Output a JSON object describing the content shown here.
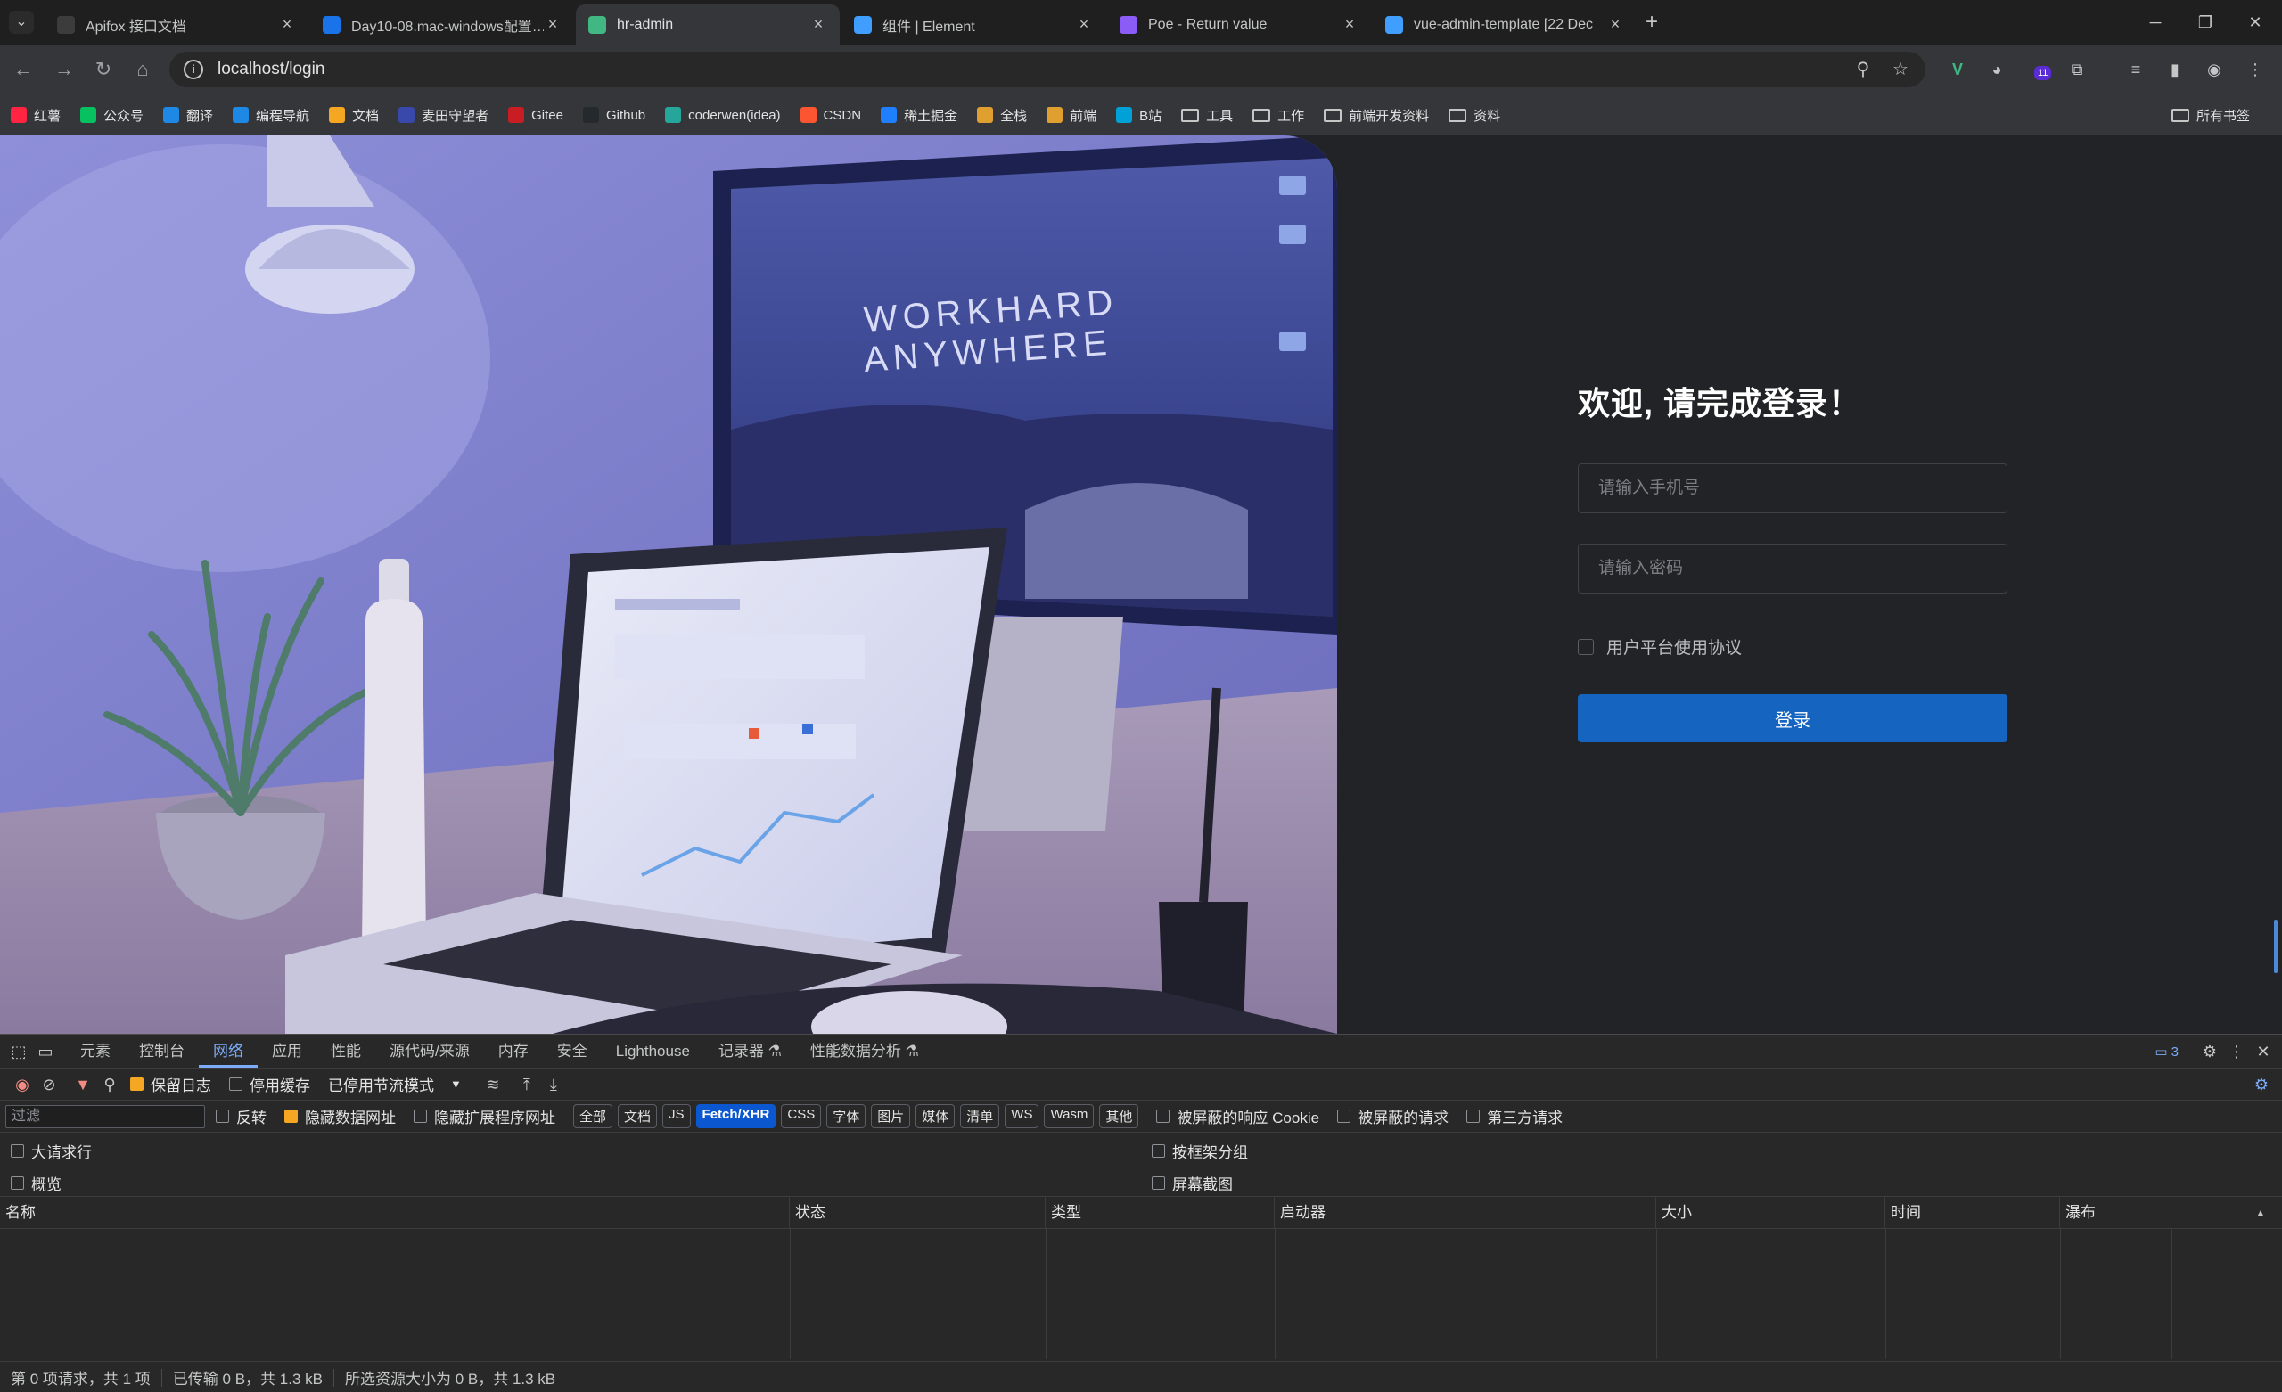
{
  "tabs": [
    {
      "title": "Apifox 接口文档",
      "icon": "apifox-icon",
      "color": "#3c3c3c"
    },
    {
      "title": "Day10-08.mac-windows配置…",
      "icon": "doc-icon",
      "color": "#1a73e8"
    },
    {
      "title": "hr-admin",
      "icon": "vue-icon",
      "color": "#41b883",
      "active": true
    },
    {
      "title": "组件 | Element",
      "icon": "element-icon",
      "color": "#409eff"
    },
    {
      "title": "Poe - Return value",
      "icon": "poe-icon",
      "color": "#8b5cf6"
    },
    {
      "title": "vue-admin-template [22 Dec",
      "icon": "vue-icon",
      "color": "#409eff"
    }
  ],
  "address": {
    "url": "localhost/login"
  },
  "extensions": {
    "badge": "11"
  },
  "bookmarks": [
    {
      "label": "红薯",
      "color": "#ff2442"
    },
    {
      "label": "公众号",
      "color": "#07c160"
    },
    {
      "label": "翻译",
      "color": "#1e88e5"
    },
    {
      "label": "编程导航",
      "color": "#1e88e5"
    },
    {
      "label": "文档",
      "color": "#f5a623"
    },
    {
      "label": "麦田守望者",
      "color": "#3949ab"
    },
    {
      "label": "Gitee",
      "color": "#c71d23"
    },
    {
      "label": "Github",
      "color": "#24292e"
    },
    {
      "label": "coderwen(idea)",
      "color": "#26a69a"
    },
    {
      "label": "CSDN",
      "color": "#fc5531"
    },
    {
      "label": "稀土掘金",
      "color": "#1e80ff"
    },
    {
      "label": "全栈",
      "color": "#e0a030"
    },
    {
      "label": "前端",
      "color": "#e0a030"
    },
    {
      "label": "B站",
      "color": "#00a1d6"
    },
    {
      "label": "工具",
      "folder": true
    },
    {
      "label": "工作",
      "folder": true
    },
    {
      "label": "前端开发资料",
      "folder": true
    },
    {
      "label": "资料",
      "folder": true
    }
  ],
  "all_bookmarks": "所有书签",
  "login": {
    "title": "欢迎, 请完成登录！",
    "phone_placeholder": "请输入手机号",
    "password_placeholder": "请输入密码",
    "agreement": "用户平台使用协议",
    "submit": "登录"
  },
  "hero": {
    "screen_text_1": "WORKHARD",
    "screen_text_2": "ANYWHERE"
  },
  "devtools": {
    "tabs": [
      "元素",
      "控制台",
      "网络",
      "应用",
      "性能",
      "源代码/来源",
      "内存",
      "安全",
      "Lighthouse",
      "记录器 ⚗",
      "性能数据分析 ⚗"
    ],
    "active_tab": "网络",
    "issues_count": "3",
    "toolbar": {
      "preserve_log": "保留日志",
      "disable_cache": "停用缓存",
      "throttling": "已停用节流模式"
    },
    "filter": {
      "placeholder": "过滤",
      "invert": "反转",
      "hide_data_urls": "隐藏数据网址",
      "hide_ext_urls": "隐藏扩展程序网址",
      "types": [
        "全部",
        "文档",
        "JS",
        "Fetch/XHR",
        "CSS",
        "字体",
        "图片",
        "媒体",
        "清单",
        "WS",
        "Wasm",
        "其他"
      ],
      "active_type": "Fetch/XHR",
      "blocked_cookies": "被屏蔽的响应 Cookie",
      "blocked_requests": "被屏蔽的请求",
      "third_party": "第三方请求"
    },
    "options": {
      "big_rows": "大请求行",
      "overview": "概览",
      "group_by_frame": "按框架分组",
      "screenshots": "屏幕截图"
    },
    "columns": [
      "名称",
      "状态",
      "类型",
      "启动器",
      "大小",
      "时间",
      "瀑布"
    ],
    "status": {
      "requests": "第 0 项请求，共 1 项",
      "transferred": "已传输 0 B，共 1.3 kB",
      "resources": "所选资源大小为 0 B，共 1.3 kB"
    }
  }
}
